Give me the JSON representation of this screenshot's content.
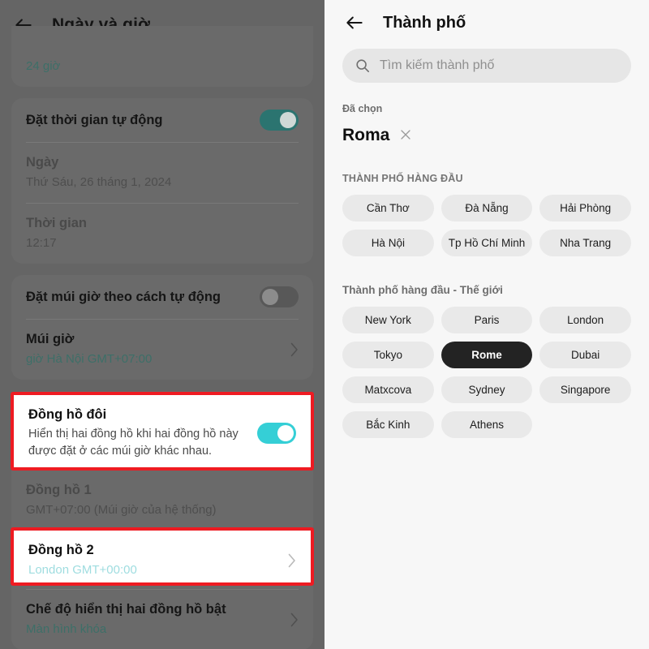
{
  "left_panel": {
    "header": {
      "back_icon": "back-arrow-icon",
      "title": "Ngày và giờ"
    },
    "cut_row": {
      "subtitle": "24 giờ"
    },
    "auto_time": {
      "title": "Đặt thời gian tự động",
      "toggle_state": "on",
      "date_label": "Ngày",
      "date_value": "Thứ Sáu, 26 tháng 1, 2024",
      "time_label": "Thời gian",
      "time_value": "12:17"
    },
    "auto_timezone": {
      "title": "Đặt múi giờ theo cách tự động",
      "toggle_state": "off",
      "timezone_label": "Múi giờ",
      "timezone_value": "giờ Hà Nội GMT+07:00"
    },
    "dual_clock": {
      "title": "Đồng hồ đôi",
      "description": "Hiển thị hai đồng hồ khi hai đồng hồ này được đặt ở các múi giờ khác nhau.",
      "toggle_state": "on",
      "highlighted": true
    },
    "clock1": {
      "title": "Đồng hồ 1",
      "value": "GMT+07:00 (Múi giờ của hệ thống)"
    },
    "clock2": {
      "title": "Đồng hồ 2",
      "value": "London GMT+00:00",
      "highlighted": true
    },
    "display_mode": {
      "title": "Chế độ hiển thị hai đồng hồ bật",
      "value": "Màn hình khóa"
    },
    "colors": {
      "highlight_border": "#ee1b22",
      "toggle_on": "#2b7470",
      "toggle_on_bright": "#35cfd6",
      "accent_teal": "#3d6f68",
      "dim_overlay": "#656565"
    }
  },
  "right_panel": {
    "header": {
      "back_icon": "back-arrow-icon",
      "title": "Thành phố"
    },
    "search": {
      "icon": "search-icon",
      "placeholder": "Tìm kiếm thành phố",
      "value": ""
    },
    "selected_section": {
      "label": "Đã chọn",
      "city": "Roma",
      "remove_icon": "close-icon"
    },
    "top_cities": {
      "title": "THÀNH PHỐ HÀNG ĐẦU",
      "chips": [
        "Cần Thơ",
        "Đà Nẵng",
        "Hải Phòng",
        "Hà Nội",
        "Tp Hồ Chí Minh",
        "Nha Trang"
      ]
    },
    "world_cities": {
      "title": "Thành phố hàng đầu - Thế giới",
      "chips": [
        {
          "label": "New York",
          "selected": false
        },
        {
          "label": "Paris",
          "selected": false
        },
        {
          "label": "London",
          "selected": false
        },
        {
          "label": "Tokyo",
          "selected": false
        },
        {
          "label": "Rome",
          "selected": true
        },
        {
          "label": "Dubai",
          "selected": false
        },
        {
          "label": "Matxcova",
          "selected": false
        },
        {
          "label": "Sydney",
          "selected": false
        },
        {
          "label": "Singapore",
          "selected": false
        },
        {
          "label": "Bắc Kinh",
          "selected": false
        },
        {
          "label": "Athens",
          "selected": false
        }
      ]
    },
    "colors": {
      "background": "#f7f7f7",
      "chip_bg": "#e9e9e9",
      "chip_selected_bg": "#232323"
    }
  }
}
